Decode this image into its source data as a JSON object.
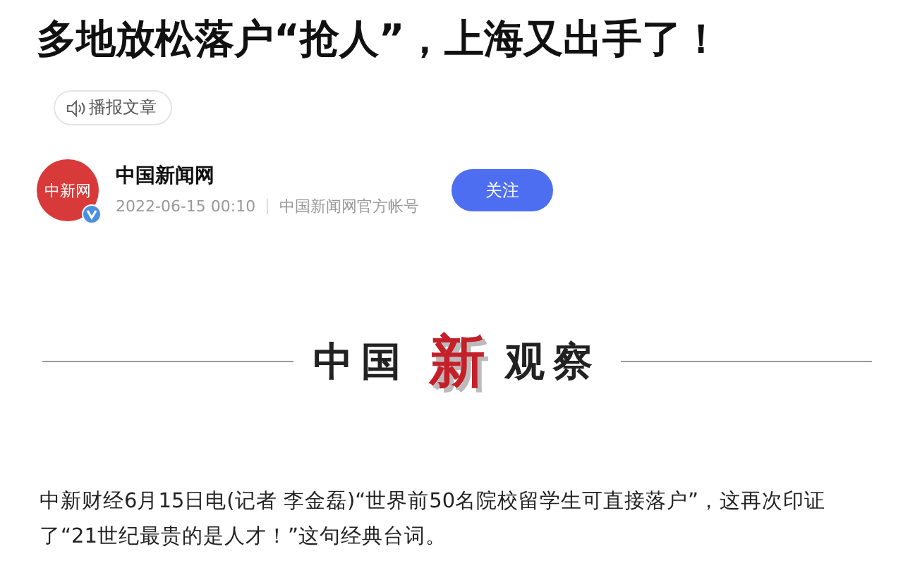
{
  "headline": "多地放松落户“抢人”，上海又出手了！",
  "read_aloud": {
    "label": "播报文章"
  },
  "author": {
    "logo_text": "中新网",
    "name": "中国新闻网",
    "verified": true,
    "date": "2022-06-15 00:10",
    "account": "中国新闻网官方帐号",
    "follow": "关注"
  },
  "banner": {
    "left": "中国",
    "center": "新",
    "right": "观察"
  },
  "body": [
    "中新财经6月15日电(记者 李金磊)“世界前50名院校留学生可直接落户”，这再次印证了“21世纪最贵的是人才！”这句经典台词。"
  ]
}
